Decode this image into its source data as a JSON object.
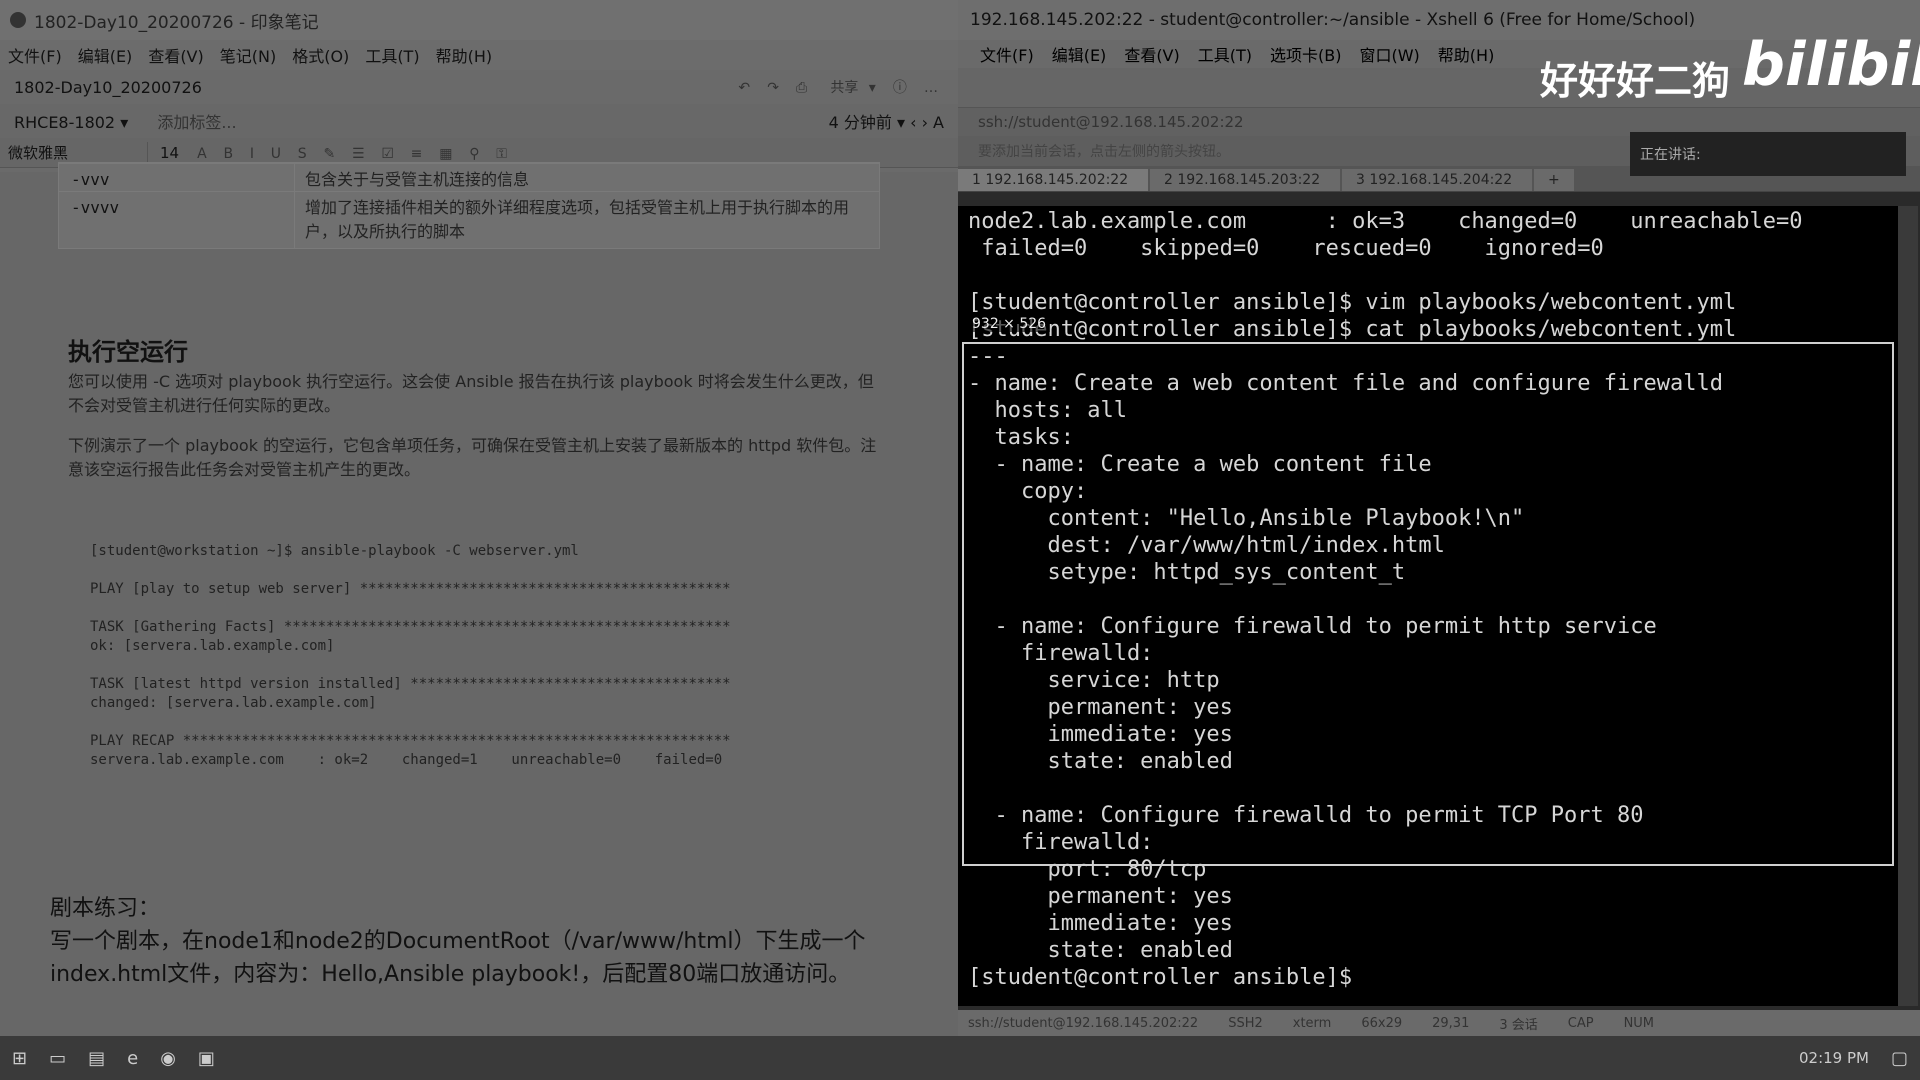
{
  "left": {
    "window_title": "1802-Day10_20200726 - 印象笔记",
    "menu": [
      "文件(F)",
      "编辑(E)",
      "查看(V)",
      "笔记(N)",
      "格式(O)",
      "工具(T)",
      "帮助(H)"
    ],
    "note_title": "1802-Day10_20200726",
    "share": "共享",
    "notebook": "RHCE8-1802",
    "add_tag": "添加标签...",
    "time": "4 分钟前",
    "font": "微软雅黑",
    "font_size": "14",
    "table": [
      {
        "opt": "-vvv",
        "desc": "包含关于与受管主机连接的信息"
      },
      {
        "opt": "-vvvv",
        "desc": "增加了连接插件相关的额外详细程度选项，包括受管主机上用于执行脚本的用户，以及所执行的脚本"
      }
    ],
    "heading": "执行空运行",
    "para1": "您可以使用 -C 选项对 playbook 执行空运行。这会使 Ansible 报告在执行该 playbook 时将会发生什么更改，但不会对受管主机进行任何实际的更改。",
    "para2": "下例演示了一个 playbook 的空运行，它包含单项任务，可确保在受管主机上安装了最新版本的 httpd 软件包。注意该空运行报告此任务会对受管主机产生的更改。",
    "code": "[student@workstation ~]$ ansible-playbook -C webserver.yml\n\nPLAY [play to setup web server] ********************************************\n\nTASK [Gathering Facts] *****************************************************\nok: [servera.lab.example.com]\n\nTASK [latest httpd version installed] **************************************\nchanged: [servera.lab.example.com]\n\nPLAY RECAP *****************************************************************\nservera.lab.example.com    : ok=2    changed=1    unreachable=0    failed=0",
    "exercise_title": "剧本练习：",
    "exercise_body": "写一个剧本，在node1和node2的DocumentRoot（/var/www/html）下生成一个index.html文件，内容为：Hello,Ansible playbook!，后配置80端口放通访问。"
  },
  "right": {
    "window_title": "192.168.145.202:22 - student@controller:~/ansible - Xshell 6 (Free for Home/School)",
    "menu": [
      "文件(F)",
      "编辑(E)",
      "查看(V)",
      "工具(T)",
      "选项卡(B)",
      "窗口(W)",
      "帮助(H)"
    ],
    "address": "ssh://student@192.168.145.202:22",
    "hint": "要添加当前会话，点击左侧的箭头按钮。",
    "speaking": "正在讲话:",
    "tabs": [
      "1 192.168.145.202:22",
      "2 192.168.145.203:22",
      "3 192.168.145.204:22"
    ],
    "tab_add": "+",
    "terminal": "node2.lab.example.com      : ok=3    changed=0    unreachable=0\n failed=0    skipped=0    rescued=0    ignored=0\n\n[student@controller ansible]$ vim playbooks/webcontent.yml\n[student@controller ansible]$ cat playbooks/webcontent.yml\n---\n- name: Create a web content file and configure firewalld\n  hosts: all\n  tasks:\n  - name: Create a web content file\n    copy:\n      content: \"Hello,Ansible Playbook!\\n\"\n      dest: /var/www/html/index.html\n      setype: httpd_sys_content_t\n\n  - name: Configure firewalld to permit http service\n    firewalld:\n      service: http\n      permanent: yes\n      immediate: yes\n      state: enabled\n\n  - name: Configure firewalld to permit TCP Port 80\n    firewalld:\n      port: 80/tcp\n      permanent: yes\n      immediate: yes\n      state: enabled\n[student@controller ansible]$ ",
    "sel_size": "932 × 526",
    "status": [
      "ssh://student@192.168.145.202:22",
      "SSH2",
      "xterm",
      "66x29",
      "29,31",
      "3 会话",
      "CAP",
      "NUM"
    ]
  },
  "watermark": "好好好二狗",
  "bili": "bilibili",
  "clock": "02:19 PM"
}
